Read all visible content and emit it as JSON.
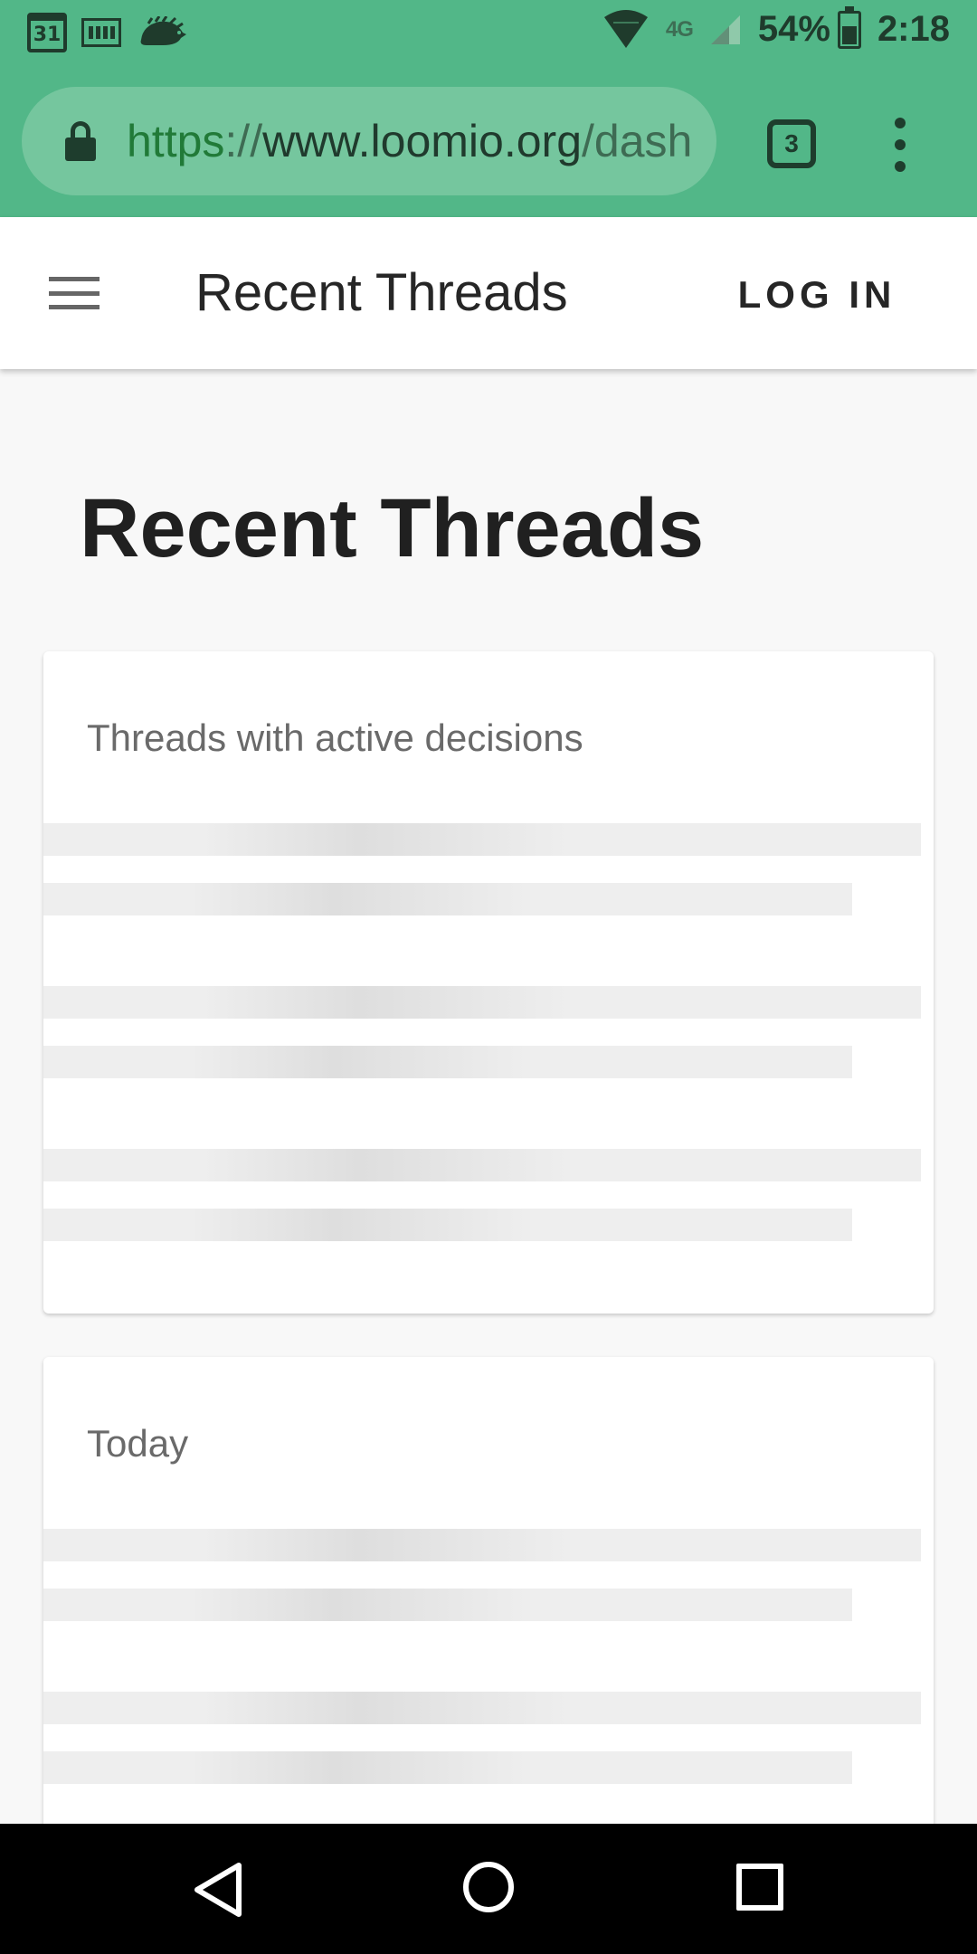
{
  "status_bar": {
    "calendar_day": "31",
    "network_label": "4G",
    "battery_percent": "54%",
    "battery_level": 0.54,
    "time": "2:18",
    "icons": [
      "calendar-icon",
      "film-strip-icon",
      "hedgehog-icon",
      "wifi-icon",
      "network-type-icon",
      "signal-icon",
      "battery-icon"
    ]
  },
  "browser": {
    "url_scheme": "https",
    "url_sep": "://",
    "url_host": "www.loomio.org",
    "url_path": "/dash",
    "tab_count": "3",
    "icons": [
      "lock-icon",
      "tab-switcher-icon",
      "more-vert-icon"
    ]
  },
  "app_bar": {
    "title": "Recent Threads",
    "login_label": "LOG IN",
    "menu_icon": "hamburger-icon"
  },
  "main": {
    "page_title": "Recent Threads",
    "cards": [
      {
        "title": "Threads with active decisions"
      },
      {
        "title": "Today"
      }
    ]
  },
  "nav_bar": {
    "icons": [
      "back-icon",
      "home-icon",
      "recents-icon"
    ]
  },
  "colors": {
    "browser_green": "#52b788",
    "url_pill": "#75c69e",
    "page_background": "#f8f8f8",
    "skeleton": "#eeeeee"
  }
}
